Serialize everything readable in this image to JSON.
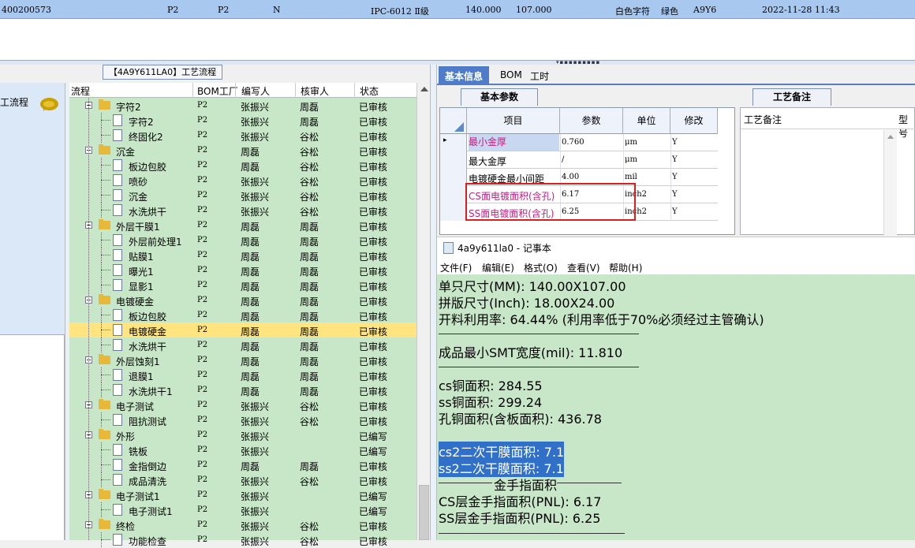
{
  "top_row": {
    "id": "400200573",
    "f1": "P2",
    "f2": "P2",
    "f3": "N",
    "standard": "IPC-6012 Ⅱ级",
    "length": "140.000",
    "width": "107.000",
    "silk": "白色字符",
    "mask": "绿色",
    "code": "A9Y6",
    "date": "2022-11-28 11:43"
  },
  "left_panel": {
    "label": "工流程"
  },
  "process_panel": {
    "title": "【4A9Y611LA0】工艺流程",
    "columns": [
      "流程",
      "BOM工厂",
      "编写人",
      "核审人",
      "状态"
    ],
    "rows": [
      {
        "level": 0,
        "type": "folder",
        "name": "字符2",
        "bom": "P2",
        "writer": "张振兴",
        "reviewer": "周磊",
        "status": "已审核"
      },
      {
        "level": 1,
        "type": "doc",
        "name": "字符2",
        "bom": "P2",
        "writer": "张振兴",
        "reviewer": "周磊",
        "status": "已审核"
      },
      {
        "level": 1,
        "type": "doc",
        "name": "终固化2",
        "bom": "P2",
        "writer": "张振兴",
        "reviewer": "谷松",
        "status": "已审核"
      },
      {
        "level": 0,
        "type": "folder",
        "name": "沉金",
        "bom": "P2",
        "writer": "周磊",
        "reviewer": "谷松",
        "status": "已审核"
      },
      {
        "level": 1,
        "type": "doc",
        "name": "板边包胶",
        "bom": "P2",
        "writer": "周磊",
        "reviewer": "谷松",
        "status": "已审核"
      },
      {
        "level": 1,
        "type": "doc",
        "name": "喷砂",
        "bom": "P2",
        "writer": "张振兴",
        "reviewer": "谷松",
        "status": "已审核"
      },
      {
        "level": 1,
        "type": "doc",
        "name": "沉金",
        "bom": "P2",
        "writer": "张振兴",
        "reviewer": "谷松",
        "status": "已审核"
      },
      {
        "level": 1,
        "type": "doc",
        "name": "水洗烘干",
        "bom": "P2",
        "writer": "张振兴",
        "reviewer": "谷松",
        "status": "已审核"
      },
      {
        "level": 0,
        "type": "folder",
        "name": "外层干膜1",
        "bom": "P2",
        "writer": "周磊",
        "reviewer": "周磊",
        "status": "已审核"
      },
      {
        "level": 1,
        "type": "doc",
        "name": "外层前处理1",
        "bom": "P2",
        "writer": "周磊",
        "reviewer": "周磊",
        "status": "已审核"
      },
      {
        "level": 1,
        "type": "doc",
        "name": "贴膜1",
        "bom": "P2",
        "writer": "周磊",
        "reviewer": "周磊",
        "status": "已审核"
      },
      {
        "level": 1,
        "type": "doc",
        "name": "曝光1",
        "bom": "P2",
        "writer": "周磊",
        "reviewer": "周磊",
        "status": "已审核"
      },
      {
        "level": 1,
        "type": "doc",
        "name": "显影1",
        "bom": "P2",
        "writer": "周磊",
        "reviewer": "周磊",
        "status": "已审核"
      },
      {
        "level": 0,
        "type": "folder",
        "name": "电镀硬金",
        "bom": "P2",
        "writer": "周磊",
        "reviewer": "周磊",
        "status": "已审核"
      },
      {
        "level": 1,
        "type": "doc",
        "name": "板边包胶",
        "bom": "P2",
        "writer": "周磊",
        "reviewer": "周磊",
        "status": "已审核"
      },
      {
        "level": 1,
        "type": "doc",
        "name": "电镀硬金",
        "bom": "P2",
        "writer": "周磊",
        "reviewer": "周磊",
        "status": "已审核",
        "selected": true
      },
      {
        "level": 1,
        "type": "doc",
        "name": "水洗烘干",
        "bom": "P2",
        "writer": "周磊",
        "reviewer": "周磊",
        "status": "已审核"
      },
      {
        "level": 0,
        "type": "folder",
        "name": "外层蚀刻1",
        "bom": "P2",
        "writer": "周磊",
        "reviewer": "周磊",
        "status": "已审核"
      },
      {
        "level": 1,
        "type": "doc",
        "name": "退膜1",
        "bom": "P2",
        "writer": "周磊",
        "reviewer": "周磊",
        "status": "已审核"
      },
      {
        "level": 1,
        "type": "doc",
        "name": "水洗烘干1",
        "bom": "P2",
        "writer": "周磊",
        "reviewer": "周磊",
        "status": "已审核"
      },
      {
        "level": 0,
        "type": "folder",
        "name": "电子测试",
        "bom": "P2",
        "writer": "张振兴",
        "reviewer": "谷松",
        "status": "已审核"
      },
      {
        "level": 1,
        "type": "doc",
        "name": "阻抗测试",
        "bom": "P2",
        "writer": "张振兴",
        "reviewer": "谷松",
        "status": "已审核"
      },
      {
        "level": 0,
        "type": "folder",
        "name": "外形",
        "bom": "P2",
        "writer": "张振兴",
        "reviewer": "",
        "status": "已编写"
      },
      {
        "level": 1,
        "type": "doc",
        "name": "铣板",
        "bom": "P2",
        "writer": "张振兴",
        "reviewer": "",
        "status": "已编写"
      },
      {
        "level": 1,
        "type": "doc",
        "name": "金指倒边",
        "bom": "P2",
        "writer": "周磊",
        "reviewer": "周磊",
        "status": "已审核"
      },
      {
        "level": 1,
        "type": "doc",
        "name": "成品清洗",
        "bom": "P2",
        "writer": "张振兴",
        "reviewer": "谷松",
        "status": "已审核"
      },
      {
        "level": 0,
        "type": "folder",
        "name": "电子测试1",
        "bom": "P2",
        "writer": "张振兴",
        "reviewer": "",
        "status": "已编写"
      },
      {
        "level": 1,
        "type": "doc",
        "name": "电子测试1",
        "bom": "P2",
        "writer": "张振兴",
        "reviewer": "",
        "status": "已编写"
      },
      {
        "level": 0,
        "type": "folder",
        "name": "终检",
        "bom": "P2",
        "writer": "张振兴",
        "reviewer": "谷松",
        "status": "已审核"
      },
      {
        "level": 1,
        "type": "doc",
        "name": "功能检查",
        "bom": "P2",
        "writer": "张振兴",
        "reviewer": "谷松",
        "status": "已审核"
      }
    ]
  },
  "top_tabs": [
    "基本信息",
    "BOM",
    "工时"
  ],
  "basic_params": {
    "tab": "基本参数",
    "columns": [
      "项目",
      "参数",
      "单位",
      "修改"
    ],
    "rows": [
      {
        "item": "最小金厚",
        "value": "0.760",
        "unit": "μm",
        "mod": "Y",
        "red": true
      },
      {
        "item": "最大金厚",
        "value": "/",
        "unit": "μm",
        "mod": "Y",
        "red": false
      },
      {
        "item": "电镀硬金最小间距",
        "value": "4.00",
        "unit": "mil",
        "mod": "Y",
        "red": false
      },
      {
        "item": "CS面电镀面积(含孔)",
        "value": "6.17",
        "unit": "inch2",
        "mod": "Y",
        "red": true
      },
      {
        "item": "SS面电镀面积(含孔)",
        "value": "6.25",
        "unit": "inch2",
        "mod": "Y",
        "red": true
      }
    ]
  },
  "process_notes": {
    "tab": "工艺备注",
    "col1": "工艺备注",
    "col2": "型号"
  },
  "notepad": {
    "title": "4a9y611la0 - 记事本",
    "menu": [
      "文件(F)",
      "编辑(E)",
      "格式(O)",
      "查看(V)",
      "帮助(H)"
    ],
    "lines": [
      "单只尺寸(MM): 140.00X107.00",
      "拼版尺寸(Inch): 18.00X24.00",
      "开料利用率: 64.44% (利用率低于70%必须经过主管确认)",
      "成品最小SMT宽度(mil): 11.810",
      "cs铜面积: 284.55",
      "ss铜面积: 299.24",
      "孔铜面积(含板面积): 436.78",
      "cs2二次干膜面积: 7.1",
      "ss2二次干膜面积: 7.1",
      "金手指面积",
      "CS层金手指面积(PNL): 6.17",
      "SS层金手指面积(PNL): 6.25"
    ]
  }
}
